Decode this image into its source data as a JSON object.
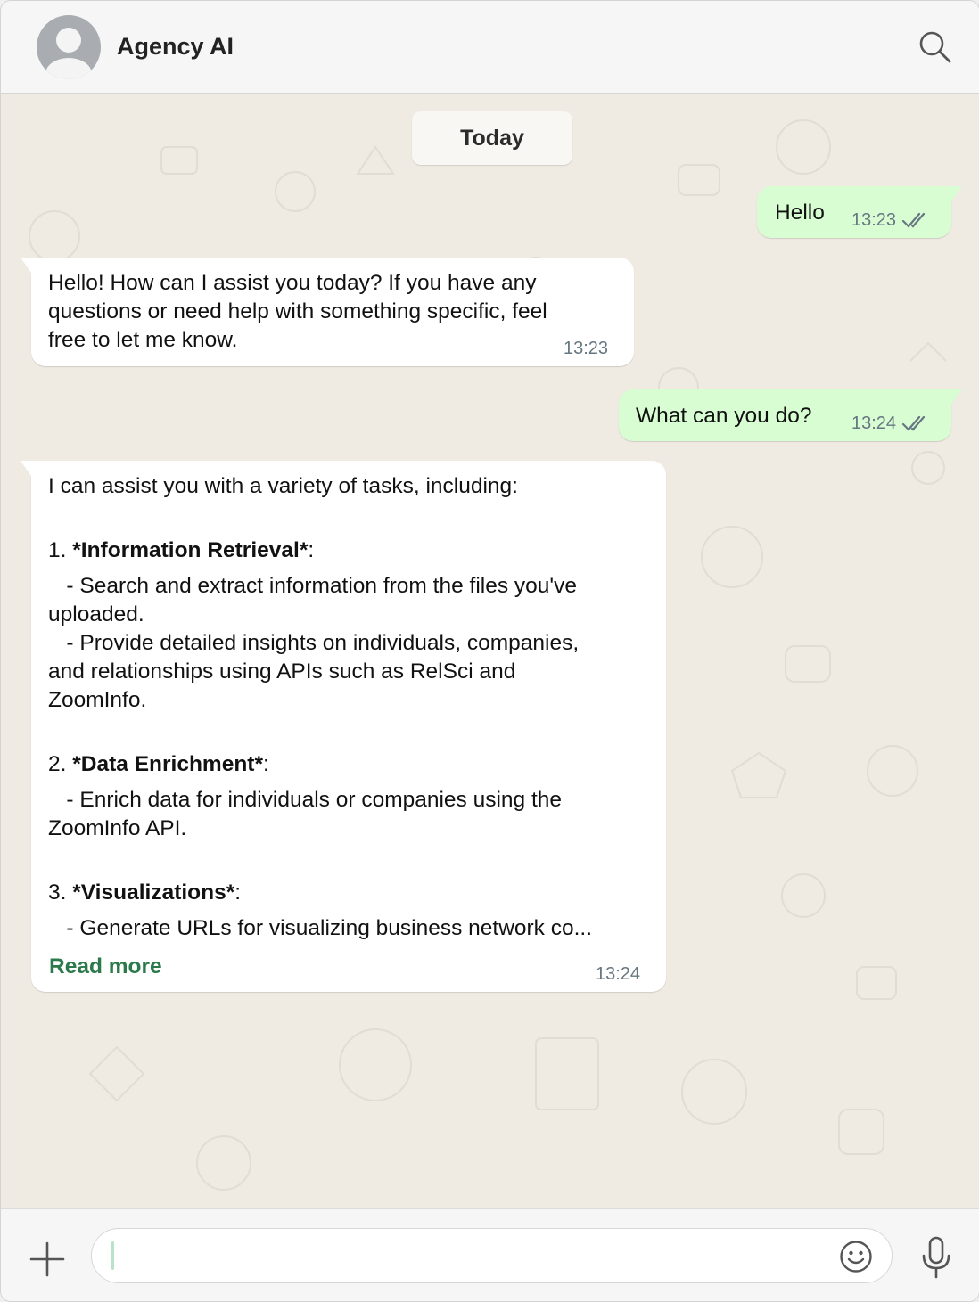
{
  "header": {
    "contact_name": "Agency AI",
    "avatar_icon": "default-user-avatar",
    "search_icon": "search-icon"
  },
  "chat": {
    "date_label": "Today",
    "messages": [
      {
        "direction": "outgoing",
        "text": "Hello",
        "time": "13:23",
        "status": "read"
      },
      {
        "direction": "incoming",
        "text": "Hello! How can I assist you today? If you have any\nquestions or need help with something specific, feel\nfree to let me know.",
        "time": "13:23"
      },
      {
        "direction": "outgoing",
        "text": "What can you do?",
        "time": "13:24",
        "status": "read"
      },
      {
        "direction": "incoming",
        "intro": "I can assist you with a variety of tasks, including:",
        "items": [
          {
            "number": "1. ",
            "title": "*Information Retrieval*",
            "after": ":",
            "body": "   - Search and extract information from the files you've\nuploaded.\n   - Provide detailed insights on individuals, companies,\nand relationships using APIs such as RelSci and\nZoomInfo."
          },
          {
            "number": "2. ",
            "title": "*Data Enrichment*",
            "after": ":",
            "body": "   - Enrich data for individuals or companies using the\nZoomInfo API."
          },
          {
            "number": "3. ",
            "title": "*Visualizations*",
            "after": ":",
            "body": "   - Generate URLs for visualizing business network co..."
          }
        ],
        "read_more": "Read more",
        "time": "13:24"
      }
    ]
  },
  "composer": {
    "value": "",
    "placeholder": ""
  },
  "colors": {
    "outgoing_bubble": "#d9fdd3",
    "incoming_bubble": "#ffffff",
    "chat_background": "#efeae2",
    "read_more_link": "#2b7a4b",
    "timestamp": "#667781"
  }
}
